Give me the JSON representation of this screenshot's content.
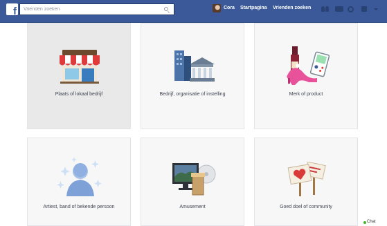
{
  "header": {
    "logo_letter": "f",
    "search": {
      "placeholder": "Vrienden zoeken"
    },
    "user_name": "Cora",
    "nav": {
      "home": "Startpagina",
      "find_friends": "Vrienden zoeken"
    },
    "brand_color": "#3b5998"
  },
  "categories": [
    {
      "label": "Plaats of lokaal bedrijf",
      "icon": "storefront-icon"
    },
    {
      "label": "Bedrijf, organisatie of instelling",
      "icon": "buildings-icon"
    },
    {
      "label": "Merk of product",
      "icon": "products-icon"
    },
    {
      "label": "Artiest, band of bekende persoon",
      "icon": "person-stars-icon"
    },
    {
      "label": "Amusement",
      "icon": "tv-icon"
    },
    {
      "label": "Goed doel of community",
      "icon": "signs-icon"
    }
  ],
  "chat": {
    "label": "Chat"
  }
}
